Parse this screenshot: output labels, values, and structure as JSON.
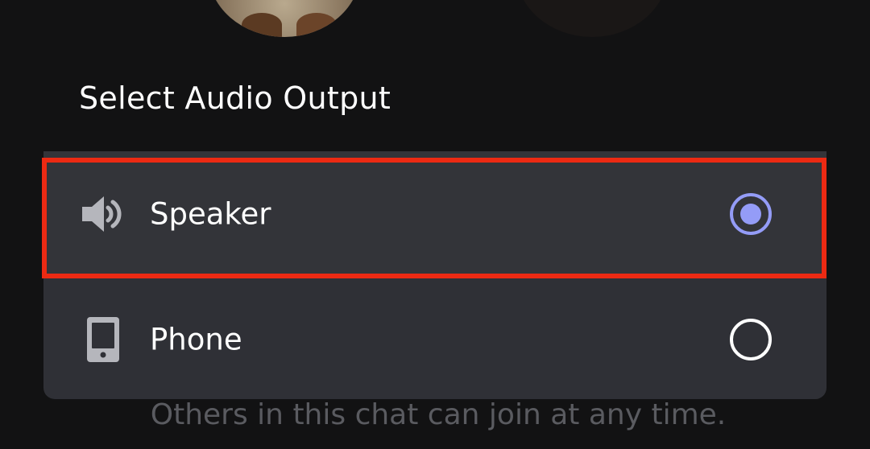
{
  "dialog": {
    "title": "Select Audio Output"
  },
  "options": [
    {
      "label": "Speaker",
      "icon": "speaker-icon",
      "selected": true
    },
    {
      "label": "Phone",
      "icon": "phone-icon",
      "selected": false
    }
  ],
  "footer": {
    "text": "Others in this chat can join at any time."
  },
  "colors": {
    "background": "#121212",
    "card": "#2f3036",
    "highlight_border": "#ec2a13",
    "radio_selected": "#949cf7",
    "radio_unselected": "#ffffff",
    "footer_text": "#5a5b60"
  }
}
